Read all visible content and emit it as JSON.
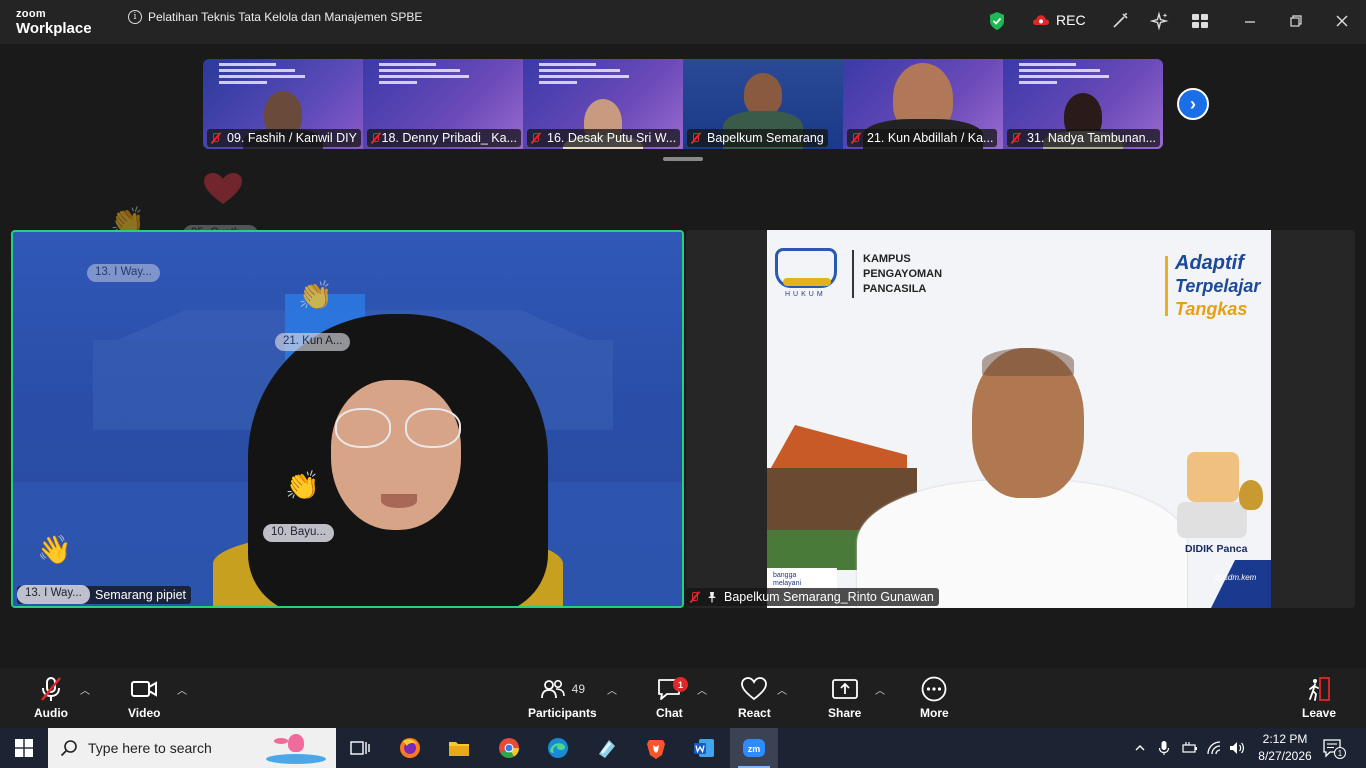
{
  "app": {
    "logo_line1": "zoom",
    "logo_line2": "Workplace",
    "meeting_title": "Pelatihan Teknis Tata Kelola dan Manajemen SPBE",
    "rec_label": "REC"
  },
  "colors": {
    "accent_blue": "#1a6ee8",
    "active_speaker": "#26d07c",
    "muted_red": "#e02828",
    "shield_green": "#1db954"
  },
  "thumbnails": [
    {
      "name": "09. Fashih / Kanwil DIY"
    },
    {
      "name": "18. Denny Pribadi_ Ka..."
    },
    {
      "name": "16. Desak Putu Sri W..."
    },
    {
      "name": "Bapelkum Semarang"
    },
    {
      "name": "21. Kun Abdillah / Ka..."
    },
    {
      "name": "31. Nadya Tambunan..."
    }
  ],
  "reactions": {
    "faded1": "35. Cynth...",
    "r1": "13. I Way...",
    "r2": "21. Kun A...",
    "r3": "10. Bayu...",
    "r4": "13. I Way..."
  },
  "tiles": {
    "left_name": "Semarang pipiet",
    "right_name": "Bapelkum Semarang_Rinto Gunawan",
    "slide": {
      "org_line1": "KAMPUS",
      "org_line2": "PENGAYOMAN",
      "org_line3": "PANCASILA",
      "logo_sub": "HUKUM",
      "tag1": "Adaptif",
      "tag2": "Terpelajar",
      "tag3": "Tangkas",
      "mascot": "DIDIK Panca",
      "url": "bpsdm.kem",
      "small1": "bangga",
      "small2": "melayani"
    }
  },
  "toolbar": {
    "audio": "Audio",
    "video": "Video",
    "participants": "Participants",
    "participants_count": "49",
    "chat": "Chat",
    "chat_badge": "1",
    "react": "React",
    "share": "Share",
    "more": "More",
    "leave": "Leave"
  },
  "taskbar": {
    "search_placeholder": "Type here to search",
    "time": "2:12 PM",
    "date": "8/27/2026",
    "notif_count": "1"
  }
}
